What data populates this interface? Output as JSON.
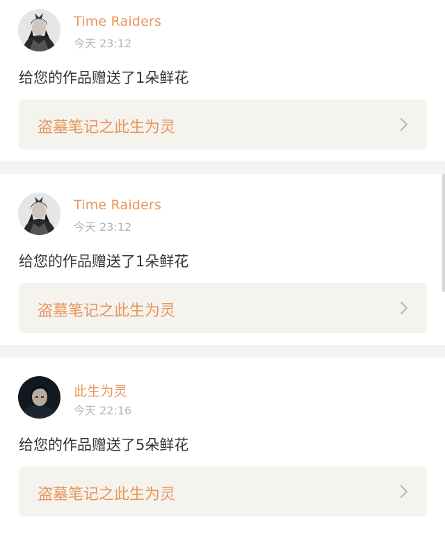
{
  "gifts": [
    {
      "user": "Time Raiders",
      "time": "今天 23:12",
      "message": "给您的作品赠送了1朵鲜花",
      "work_title": "盗墓笔记之此生为灵",
      "avatar_icon": "avatar-costume-portrait"
    },
    {
      "user": "Time Raiders",
      "time": "今天 23:12",
      "message": "给您的作品赠送了1朵鲜花",
      "work_title": "盗墓笔记之此生为灵",
      "avatar_icon": "avatar-costume-portrait"
    },
    {
      "user": "此生为灵",
      "time": "今天 22:16",
      "message": "给您的作品赠送了5朵鲜花",
      "work_title": "盗墓笔记之此生为灵",
      "avatar_icon": "avatar-dark-portrait"
    }
  ],
  "colors": {
    "accent": "#e8955a",
    "timestamp": "#b5b5b5",
    "text": "#333333",
    "link_background": "#f4f3ee",
    "separator": "#f5f3f2"
  },
  "icons": {
    "chevron": "chevron-right-icon"
  }
}
